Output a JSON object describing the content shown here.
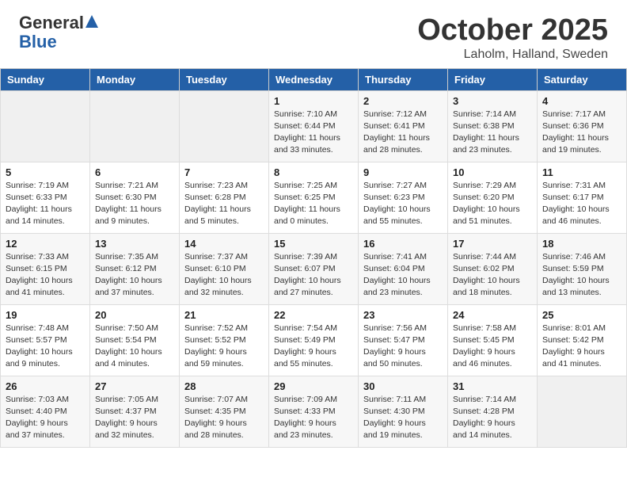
{
  "header": {
    "logo_general": "General",
    "logo_blue": "Blue",
    "month": "October 2025",
    "location": "Laholm, Halland, Sweden"
  },
  "weekdays": [
    "Sunday",
    "Monday",
    "Tuesday",
    "Wednesday",
    "Thursday",
    "Friday",
    "Saturday"
  ],
  "weeks": [
    [
      {
        "day": "",
        "info": ""
      },
      {
        "day": "",
        "info": ""
      },
      {
        "day": "",
        "info": ""
      },
      {
        "day": "1",
        "info": "Sunrise: 7:10 AM\nSunset: 6:44 PM\nDaylight: 11 hours\nand 33 minutes."
      },
      {
        "day": "2",
        "info": "Sunrise: 7:12 AM\nSunset: 6:41 PM\nDaylight: 11 hours\nand 28 minutes."
      },
      {
        "day": "3",
        "info": "Sunrise: 7:14 AM\nSunset: 6:38 PM\nDaylight: 11 hours\nand 23 minutes."
      },
      {
        "day": "4",
        "info": "Sunrise: 7:17 AM\nSunset: 6:36 PM\nDaylight: 11 hours\nand 19 minutes."
      }
    ],
    [
      {
        "day": "5",
        "info": "Sunrise: 7:19 AM\nSunset: 6:33 PM\nDaylight: 11 hours\nand 14 minutes."
      },
      {
        "day": "6",
        "info": "Sunrise: 7:21 AM\nSunset: 6:30 PM\nDaylight: 11 hours\nand 9 minutes."
      },
      {
        "day": "7",
        "info": "Sunrise: 7:23 AM\nSunset: 6:28 PM\nDaylight: 11 hours\nand 5 minutes."
      },
      {
        "day": "8",
        "info": "Sunrise: 7:25 AM\nSunset: 6:25 PM\nDaylight: 11 hours\nand 0 minutes."
      },
      {
        "day": "9",
        "info": "Sunrise: 7:27 AM\nSunset: 6:23 PM\nDaylight: 10 hours\nand 55 minutes."
      },
      {
        "day": "10",
        "info": "Sunrise: 7:29 AM\nSunset: 6:20 PM\nDaylight: 10 hours\nand 51 minutes."
      },
      {
        "day": "11",
        "info": "Sunrise: 7:31 AM\nSunset: 6:17 PM\nDaylight: 10 hours\nand 46 minutes."
      }
    ],
    [
      {
        "day": "12",
        "info": "Sunrise: 7:33 AM\nSunset: 6:15 PM\nDaylight: 10 hours\nand 41 minutes."
      },
      {
        "day": "13",
        "info": "Sunrise: 7:35 AM\nSunset: 6:12 PM\nDaylight: 10 hours\nand 37 minutes."
      },
      {
        "day": "14",
        "info": "Sunrise: 7:37 AM\nSunset: 6:10 PM\nDaylight: 10 hours\nand 32 minutes."
      },
      {
        "day": "15",
        "info": "Sunrise: 7:39 AM\nSunset: 6:07 PM\nDaylight: 10 hours\nand 27 minutes."
      },
      {
        "day": "16",
        "info": "Sunrise: 7:41 AM\nSunset: 6:04 PM\nDaylight: 10 hours\nand 23 minutes."
      },
      {
        "day": "17",
        "info": "Sunrise: 7:44 AM\nSunset: 6:02 PM\nDaylight: 10 hours\nand 18 minutes."
      },
      {
        "day": "18",
        "info": "Sunrise: 7:46 AM\nSunset: 5:59 PM\nDaylight: 10 hours\nand 13 minutes."
      }
    ],
    [
      {
        "day": "19",
        "info": "Sunrise: 7:48 AM\nSunset: 5:57 PM\nDaylight: 10 hours\nand 9 minutes."
      },
      {
        "day": "20",
        "info": "Sunrise: 7:50 AM\nSunset: 5:54 PM\nDaylight: 10 hours\nand 4 minutes."
      },
      {
        "day": "21",
        "info": "Sunrise: 7:52 AM\nSunset: 5:52 PM\nDaylight: 9 hours\nand 59 minutes."
      },
      {
        "day": "22",
        "info": "Sunrise: 7:54 AM\nSunset: 5:49 PM\nDaylight: 9 hours\nand 55 minutes."
      },
      {
        "day": "23",
        "info": "Sunrise: 7:56 AM\nSunset: 5:47 PM\nDaylight: 9 hours\nand 50 minutes."
      },
      {
        "day": "24",
        "info": "Sunrise: 7:58 AM\nSunset: 5:45 PM\nDaylight: 9 hours\nand 46 minutes."
      },
      {
        "day": "25",
        "info": "Sunrise: 8:01 AM\nSunset: 5:42 PM\nDaylight: 9 hours\nand 41 minutes."
      }
    ],
    [
      {
        "day": "26",
        "info": "Sunrise: 7:03 AM\nSunset: 4:40 PM\nDaylight: 9 hours\nand 37 minutes."
      },
      {
        "day": "27",
        "info": "Sunrise: 7:05 AM\nSunset: 4:37 PM\nDaylight: 9 hours\nand 32 minutes."
      },
      {
        "day": "28",
        "info": "Sunrise: 7:07 AM\nSunset: 4:35 PM\nDaylight: 9 hours\nand 28 minutes."
      },
      {
        "day": "29",
        "info": "Sunrise: 7:09 AM\nSunset: 4:33 PM\nDaylight: 9 hours\nand 23 minutes."
      },
      {
        "day": "30",
        "info": "Sunrise: 7:11 AM\nSunset: 4:30 PM\nDaylight: 9 hours\nand 19 minutes."
      },
      {
        "day": "31",
        "info": "Sunrise: 7:14 AM\nSunset: 4:28 PM\nDaylight: 9 hours\nand 14 minutes."
      },
      {
        "day": "",
        "info": ""
      }
    ]
  ]
}
